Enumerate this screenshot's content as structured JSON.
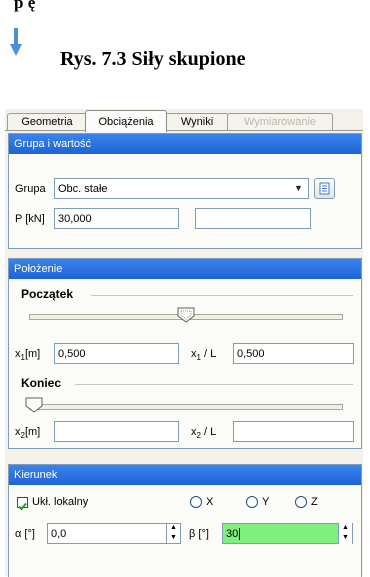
{
  "doc": {
    "heading_fragment": "p ę",
    "caption": "Rys. 7.3 Siły skupione"
  },
  "tabs": [
    {
      "label": "Geometria"
    },
    {
      "label": "Obciążenia"
    },
    {
      "label": "Wyniki"
    },
    {
      "label": "Wymiarowanie"
    }
  ],
  "group_value": {
    "header": "Grupa i wartość",
    "group_label": "Grupa",
    "group_value": "Obc. stałe",
    "p_label": "P [kN]",
    "p_value": "30,000",
    "extra_value": ""
  },
  "position": {
    "header": "Położenie",
    "start_title": "Początek",
    "start_slider_fraction": 0.5,
    "x1_label": "x",
    "x1_sub": "1",
    "x1_unit": "[m]",
    "x1_value": "0,500",
    "x1l_label": "x",
    "x1l_sub": "1",
    "x1l_unit": " / L",
    "x1l_value": "0,500",
    "end_title": "Koniec",
    "end_slider_fraction": 0.0,
    "x2_label": "x",
    "x2_sub": "2",
    "x2_unit": "[m]",
    "x2_value": "",
    "x2l_label": "x",
    "x2l_sub": "2",
    "x2l_unit": " / L",
    "x2l_value": ""
  },
  "direction": {
    "header": "Kierunek",
    "local_label": "Ukł. lokalny",
    "local_checked": true,
    "radio_x": "X",
    "radio_y": "Y",
    "radio_z": "Z",
    "alpha_label": "α [°]",
    "alpha_value": "0,0",
    "beta_label": "β [°]",
    "beta_value": "30"
  },
  "colors": {
    "header_blue": "#2a70e0",
    "beta_highlight": "#7ef07e",
    "arrow_blue": "#4a8fd8"
  }
}
